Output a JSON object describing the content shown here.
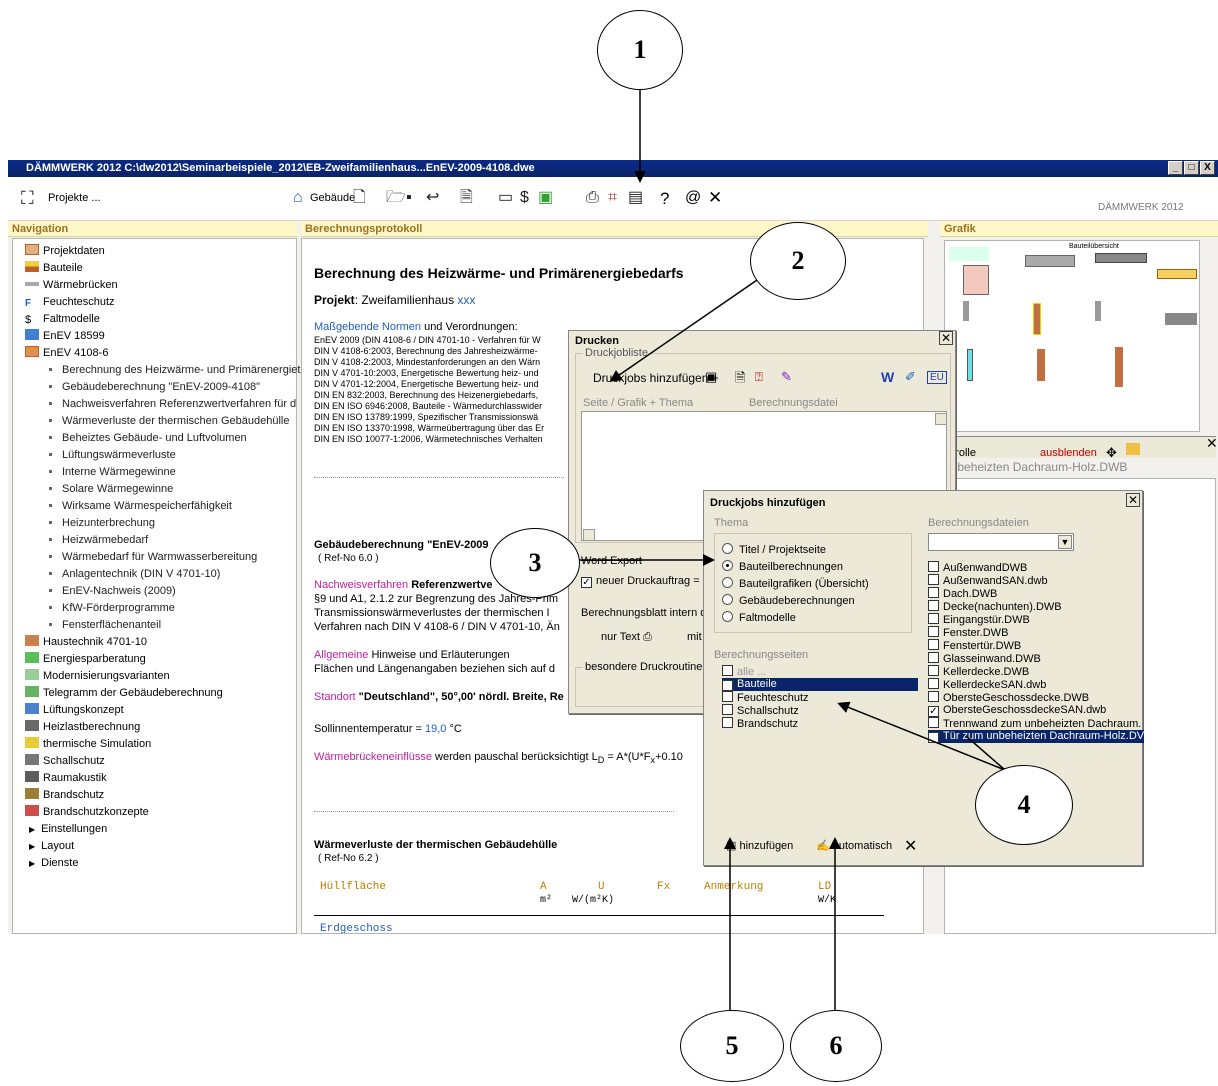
{
  "callouts": [
    "1",
    "2",
    "3",
    "4",
    "5",
    "6"
  ],
  "window": {
    "title": "DÄMMWERK 2012  C:\\dw2012\\Seminarbeispiele_2012\\EB-Zweifamilienhaus...EnEV-2009-4108.dwe",
    "controls": [
      "_",
      "□",
      "X"
    ]
  },
  "toolbar": {
    "projekte": "Projekte ...",
    "gebaeude": "Gebäude",
    "brand": "DÄMMWERK 2012",
    "help": "?",
    "at": "@",
    "close": "✕"
  },
  "panels": {
    "navigation": "Navigation",
    "protokoll": "Berechnungsprotokoll",
    "grafik": "Grafik"
  },
  "nav": {
    "items": [
      "Projektdaten",
      "Bauteile",
      "Wärmebrücken",
      "Feuchteschutz",
      "Faltmodelle",
      "EnEV 18599",
      "EnEV 4108-6"
    ],
    "sub": [
      "Berechnung des Heizwärme- und Primärenergiet",
      "Gebäudeberechnung \"EnEV-2009-4108\"",
      "Nachweisverfahren Referenzwertverfahren für d",
      "Wärmeverluste der thermischen Gebäudehülle",
      "Beheiztes Gebäude- und Luftvolumen",
      "Lüftungswärmeverluste",
      "Interne Wärmegewinne",
      "Solare Wärmegewinne",
      "Wirksame Wärmespeicherfähigkeit",
      "Heizunterbrechung",
      "Heizwärmebedarf",
      "Wärmebedarf für Warmwasserbereitung",
      "Anlagentechnik (DIN V 4701-10)",
      "EnEV-Nachweis (2009)",
      "KfW-Förderprogramme",
      "Fensterflächenanteil"
    ],
    "items2": [
      "Haustechnik 4701-10",
      "Energiesparberatung",
      "Modernisierungsvarianten",
      "Telegramm der Gebäudeberechnung",
      "Lüftungskonzept",
      "Heizlastberechnung",
      "thermische Simulation",
      "Schallschutz",
      "Raumakustik",
      "Brandschutz",
      "Brandschutzkonzepte",
      "Einstellungen",
      "Layout",
      "Dienste"
    ]
  },
  "protokoll": {
    "heading": "Berechnung des Heizwärme- und Primärenergiebedarfs",
    "projekt_label": "Projekt",
    "projekt_value": ": Zweifamilienhaus",
    "projekt_xxx": "xxx",
    "normen_link": "Maßgebende Normen",
    "normen_rest": " und Verordnungen:",
    "normen": [
      "EnEV 2009 (DIN 4108-6 / DIN 4701-10 - Verfahren für W",
      "DIN V 4108-6:2003, Berechnung des Jahresheizwärme-",
      "DIN V 4108-2:2003, Mindestanforderungen an den Wärn",
      "DIN V 4701-10:2003, Energetische Bewertung heiz- und",
      "DIN V 4701-12:2004, Energetische Bewertung heiz- und",
      "DIN EN 832:2003, Berechnung des Heizenergiebedarfs,",
      "DIN EN ISO 6946:2008, Bauteile - Wärmedurchlasswider",
      "DIN EN ISO 13789:1999, Spezifischer Transmissionswä",
      "DIN EN ISO 13370:1998, Wärmeübertragung über das Er",
      "DIN EN ISO 10077-1:2006, Wärmetechnisches Verhalten"
    ],
    "gb_title": "Gebäudeberechnung \"EnEV-2009",
    "gb_ref": "( Ref-No 6.0 )",
    "nv_link": "Nachweisverfahren",
    "nv_rest": " Referenzwertve",
    "nv_lines": [
      "§9 und A1, 2.1.2 zur Begrenzung des Jahres-Prim",
      "Transmissionswärmeverlustes der thermischen I",
      "Verfahren nach DIN V 4108-6 / DIN V 4701-10, Än"
    ],
    "allg_link": "Allgemeine",
    "allg_rest": " Hinweise und Erläuterungen",
    "allg_line": "Flächen und Längenangaben beziehen sich auf d",
    "standort_link": "Standort",
    "standort_rest": " \"Deutschland\", 50°,00' nördl. Breite, Re",
    "soll": "Sollinnentemperatur = ",
    "soll_val": "19,0",
    "soll_unit": " °C",
    "wb_link": "Wärmebrückeneinflüsse",
    "wb_rest": " werden pauschal berücksichtigt L",
    "wb_formula": " = A*(U*F",
    "wb_formula2": "+0.10",
    "wv_title": "Wärmeverluste der thermischen Gebäudehülle",
    "wv_ref": "( Ref-No 6.2 )",
    "col_huell": "Hüllfläche",
    "col_a": "A",
    "col_u": "U",
    "col_fx": "Fx",
    "col_anm": "Anmerkung",
    "col_ld": "LD",
    "unit_a": "m²",
    "unit_u": "W/(m²K)",
    "unit_ld": "W/K",
    "erd": "Erdgeschoss"
  },
  "grafik": {
    "bauteil_title": "Bauteilübersicht",
    "ctrl_label": "ntrolle",
    "ausblenden": "ausblenden",
    "file": "unbeheizten Dachraum-Holz.DWB"
  },
  "drucken": {
    "title": "Drucken",
    "druckjobliste": "Druckjobliste",
    "add_jobs": "Druckjobs hinzufügen +",
    "col1": "Seite / Grafik + Thema",
    "col2": "Berechnungsdatei",
    "word_export": "Word Export",
    "neuer": "neuer Druckauftrag = n",
    "blatt": "Berechnungsblatt intern dru",
    "nur_text": "nur Text",
    "mit_g": "mit G",
    "besondere": "besondere Druckroutinen",
    "w": "W",
    "eu": "EU"
  },
  "jobs": {
    "title": "Druckjobs hinzufügen",
    "thema": "Thema",
    "themen": [
      "Titel / Projektseite",
      "Bauteilberechnungen",
      "Bauteilgrafiken (Übersicht)",
      "Gebäudeberechnungen",
      "Faltmodelle"
    ],
    "selected_thema": 1,
    "seiten_label": "Berechnungsseiten",
    "seiten": [
      {
        "label": "alle ...",
        "checked": false,
        "disabled": true
      },
      {
        "label": "Bauteile",
        "checked": true,
        "selected": true
      },
      {
        "label": "Feuchteschutz",
        "checked": false
      },
      {
        "label": "Schallschutz",
        "checked": false
      },
      {
        "label": "Brandschutz",
        "checked": false
      }
    ],
    "dateien_label": "Berechnungsdateien",
    "dateien": [
      {
        "label": "AußenwandDWB",
        "checked": false
      },
      {
        "label": "AußenwandSAN.dwb",
        "checked": false
      },
      {
        "label": "Dach.DWB",
        "checked": false
      },
      {
        "label": "Decke(nachunten).DWB",
        "checked": false
      },
      {
        "label": "Eingangstür.DWB",
        "checked": false
      },
      {
        "label": "Fenster.DWB",
        "checked": false
      },
      {
        "label": "Fenstertür.DWB",
        "checked": false
      },
      {
        "label": "Glasseinwand.DWB",
        "checked": false
      },
      {
        "label": "Kellerdecke.DWB",
        "checked": false
      },
      {
        "label": "KellerdeckeSAN.dwb",
        "checked": false
      },
      {
        "label": "ObersteGeschossdecke.DWB",
        "checked": false
      },
      {
        "label": "ObersteGeschossdeckeSAN.dwb",
        "checked": true
      },
      {
        "label": "Trennwand zum unbeheizten Dachraum.",
        "checked": false
      },
      {
        "label": "Tür zum unbeheizten Dachraum-Holz.DV",
        "checked": true,
        "selected": true
      }
    ],
    "hinzufuegen": "hinzufügen",
    "automatisch": "automatisch",
    "close": "✕"
  }
}
